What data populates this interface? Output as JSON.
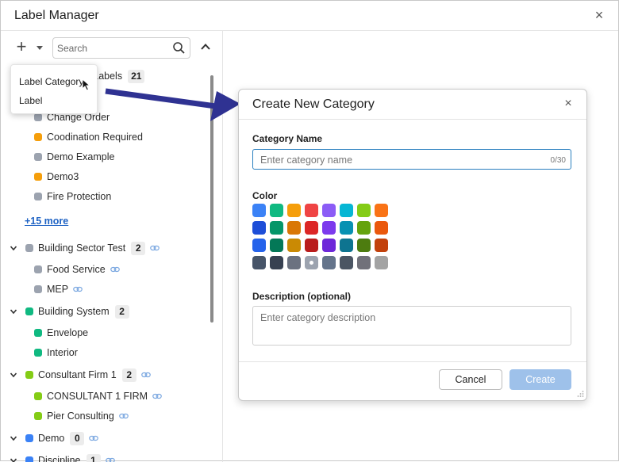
{
  "window": {
    "title": "Label Manager",
    "close": "×"
  },
  "toolbar": {
    "add": "+",
    "search_placeholder": "Search"
  },
  "dropdown": {
    "items": [
      "Label Category",
      "Label"
    ]
  },
  "tree": {
    "all_labels_text": "l Labels",
    "all_labels_count": "21",
    "root_children": [
      {
        "label": "Change Order",
        "color": "#9ca3af"
      },
      {
        "label": "Coodination Required",
        "color": "#f59e0b"
      },
      {
        "label": "Demo Example",
        "color": "#9ca3af"
      },
      {
        "label": "Demo3",
        "color": "#f59e0b"
      },
      {
        "label": "Fire Protection",
        "color": "#9ca3af"
      }
    ],
    "more": "+15 more",
    "groups": [
      {
        "label": "Building Sector Test",
        "count": "2",
        "color": "#9ca3af",
        "linked": true,
        "children": [
          {
            "label": "Food Service",
            "color": "#9ca3af",
            "linked": true
          },
          {
            "label": "MEP",
            "color": "#9ca3af",
            "linked": true
          }
        ]
      },
      {
        "label": "Building System",
        "count": "2",
        "color": "#10b981",
        "linked": false,
        "children": [
          {
            "label": "Envelope",
            "color": "#10b981",
            "linked": false
          },
          {
            "label": "Interior",
            "color": "#10b981",
            "linked": false
          }
        ]
      },
      {
        "label": "Consultant Firm 1",
        "count": "2",
        "color": "#84cc16",
        "linked": true,
        "children": [
          {
            "label": "CONSULTANT 1 FIRM",
            "color": "#84cc16",
            "linked": true
          },
          {
            "label": "Pier Consulting",
            "color": "#84cc16",
            "linked": true
          }
        ]
      },
      {
        "label": "Demo",
        "count": "0",
        "color": "#3b82f6",
        "linked": true,
        "children": []
      },
      {
        "label": "Discipline",
        "count": "1",
        "color": "#3b82f6",
        "linked": true,
        "children": []
      }
    ]
  },
  "dialog": {
    "title": "Create New Category",
    "close": "×",
    "name_label": "Category Name",
    "name_placeholder": "Enter category name",
    "name_counter": "0/30",
    "color_label": "Color",
    "colors": [
      [
        "#3b82f6",
        "#10b981",
        "#f59e0b",
        "#ef4444",
        "#8b5cf6",
        "#06b6d4",
        "#84cc16",
        "#f97316"
      ],
      [
        "#1d4ed8",
        "#059669",
        "#d97706",
        "#dc2626",
        "#7c3aed",
        "#0891b2",
        "#65a30d",
        "#ea580c"
      ],
      [
        "#2563eb",
        "#047857",
        "#ca8a04",
        "#b91c1c",
        "#6d28d9",
        "#0e7490",
        "#4d7c0f",
        "#c2410c"
      ],
      [
        "#475569",
        "#374151",
        "#6b7280",
        "#9ca3af",
        "#64748b",
        "#4b5563",
        "#71717a",
        "#a3a3a3"
      ]
    ],
    "selected_color": "#9ca3af",
    "desc_label": "Description (optional)",
    "desc_placeholder": "Enter category description",
    "cancel": "Cancel",
    "create": "Create"
  }
}
